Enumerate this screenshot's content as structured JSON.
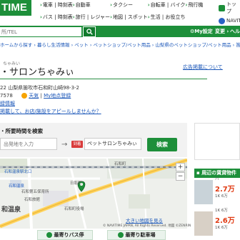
{
  "header": {
    "logo": "TIME",
    "nav": [
      "電車 | 時刻表",
      "自動車",
      "タクシー",
      "自転車 | バイク",
      "飛行機",
      "バス | 時刻表",
      "旅行 | レジャー",
      "地図 | スポット",
      "生活 | お役立ち"
    ],
    "right_items": [
      "トップ",
      "NAVIT"
    ]
  },
  "search": {
    "placeholder": "所/TEL",
    "my_settings": "My設定",
    "change_link": "変更 ›",
    "help_link": "ヘルプ"
  },
  "breadcrumb": "ホームから探す › 暮らし生活情報 › ペット › ペットショップ/ペット用品 › 山梨県のペットショップ/ペット用品 › 笛吹市のペットショップ",
  "place": {
    "ruby": "ちゃみい",
    "name": "サロンちゃみぃ",
    "address": "22 山梨県笛吹市石和町山崎98-3-2",
    "phone": "7578",
    "weather_link": "天気",
    "my_spot_link": "My地点登録",
    "register_link": "録情報",
    "promo_link": "掲載して、お店/施設をアピールしませんか？",
    "ad_link": "広告掲載について"
  },
  "route": {
    "title": "・所要時間を検索",
    "from_placeholder": "出発地を入力",
    "dest_badge": "到着",
    "to_value": "ペットサロンちゃみぃ",
    "search_button": "検索"
  },
  "map": {
    "labels": [
      "石和温泉駅北口",
      "石和温泉",
      "石和第五保育所",
      "石和旅館",
      "日影町",
      "石和町役場",
      "和温泉",
      "石和町"
    ],
    "zoom_in": "+",
    "zoom_out": "−",
    "big_map_link": "大きい地図を見る",
    "copyright": "© NAVITIME JAPAN, All Rights Reserved. 地図 ©ZENRIN"
  },
  "tabs": [
    "最寄りバス停",
    "最寄り駐車場"
  ],
  "sidebar": {
    "nearby_title": "周辺の賃貸物件",
    "listings": [
      {
        "top": "ハ",
        "price": "2.7万",
        "sub": "1K 6万"
      },
      {
        "top": "1K 6万",
        "price": "2.6万",
        "sub": "1K 6万"
      }
    ],
    "colors": {
      "brand": "#1d8f3a",
      "price": "#e03a12",
      "link": "#1a56b8"
    }
  }
}
